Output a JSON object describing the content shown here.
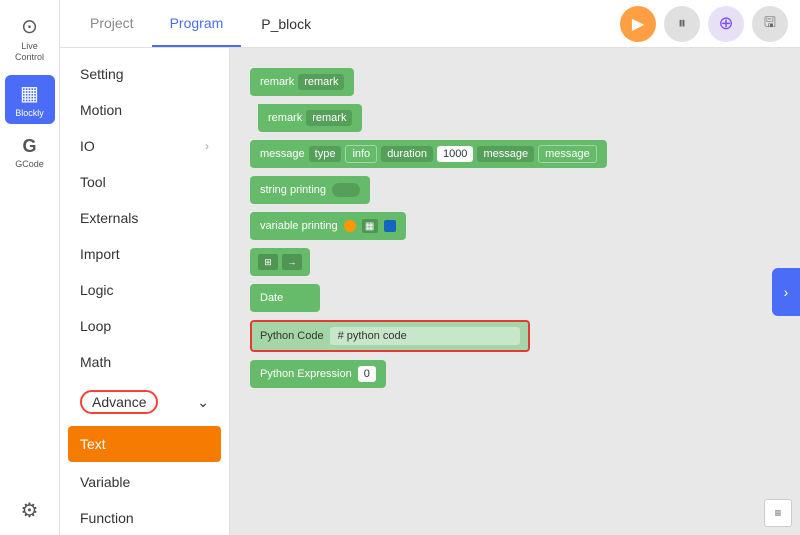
{
  "iconSidebar": {
    "items": [
      {
        "id": "live-control",
        "label": "Live Control",
        "icon": "⊙",
        "active": false
      },
      {
        "id": "blockly",
        "label": "Blockly",
        "icon": "▦",
        "active": true
      },
      {
        "id": "gcode",
        "label": "GCode",
        "icon": "G",
        "active": false
      }
    ],
    "bottomItems": [
      {
        "id": "settings",
        "label": "Settings",
        "icon": "⚙"
      }
    ]
  },
  "header": {
    "tabs": [
      {
        "id": "project",
        "label": "Project",
        "active": false
      },
      {
        "id": "program",
        "label": "Program",
        "active": true
      }
    ],
    "programName": "P_block",
    "actions": {
      "play": "▶",
      "pause": "⏸",
      "robot": "⊕",
      "save": "💾"
    }
  },
  "navMenu": {
    "items": [
      {
        "id": "setting",
        "label": "Setting",
        "active": false,
        "hasArrow": false
      },
      {
        "id": "motion",
        "label": "Motion",
        "active": false,
        "hasArrow": false
      },
      {
        "id": "io",
        "label": "IO",
        "active": false,
        "hasArrow": true
      },
      {
        "id": "tool",
        "label": "Tool",
        "active": false,
        "hasArrow": false
      },
      {
        "id": "externals",
        "label": "Externals",
        "active": false,
        "hasArrow": false
      },
      {
        "id": "import",
        "label": "Import",
        "active": false,
        "hasArrow": false
      },
      {
        "id": "logic",
        "label": "Logic",
        "active": false,
        "hasArrow": false
      },
      {
        "id": "loop",
        "label": "Loop",
        "active": false,
        "hasArrow": false
      },
      {
        "id": "math",
        "label": "Math",
        "active": false,
        "hasArrow": false
      },
      {
        "id": "advance",
        "label": "Advance",
        "active": false,
        "hasArrow": true,
        "circled": true
      },
      {
        "id": "text",
        "label": "Text",
        "active": true,
        "hasArrow": false
      },
      {
        "id": "variable",
        "label": "Variable",
        "active": false,
        "hasArrow": false
      },
      {
        "id": "function",
        "label": "Function",
        "active": false,
        "hasArrow": false
      }
    ]
  },
  "blocks": {
    "items": [
      {
        "id": "remark1",
        "type": "remark",
        "label": "remark",
        "field": "remark"
      },
      {
        "id": "remark2",
        "type": "remark",
        "label": "remark",
        "field": "remark"
      },
      {
        "id": "message",
        "type": "message",
        "label": "message",
        "fields": [
          "type",
          "info",
          "duration",
          "1000",
          "message",
          "message"
        ]
      },
      {
        "id": "string-printing",
        "type": "string-printing",
        "label": "string printing",
        "toggle": true
      },
      {
        "id": "variable-printing",
        "type": "variable-printing",
        "label": "variable printing"
      },
      {
        "id": "connector",
        "type": "connector"
      },
      {
        "id": "date",
        "type": "date",
        "label": "Date"
      },
      {
        "id": "python-code",
        "type": "python-code",
        "label": "Python Code",
        "value": "# python code"
      },
      {
        "id": "python-expression",
        "type": "python-expression",
        "label": "Python Expression",
        "field": "0"
      }
    ]
  },
  "edgeArrow": "›",
  "bottomToolbar": {
    "icon": "≡"
  }
}
